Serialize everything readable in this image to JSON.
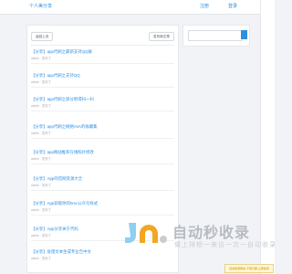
{
  "header": {
    "title": "个人美分享",
    "nav": [
      "注册",
      "登录"
    ]
  },
  "list": {
    "prev_label": "返回上页",
    "edit_label": "发布新文章",
    "items": [
      {
        "title": "【分享】app代刷之最新支持QQ群",
        "meta": "admin  · 发布了"
      },
      {
        "title": "【分享】app代刷之支持QQ",
        "meta": "admin  · 发布了"
      },
      {
        "title": "【分享】app代刷之部分附得扫一扫",
        "meta": "admin  · 发布了"
      },
      {
        "title": "【分享】app代刷之网络AVA的收藏集",
        "meta": "admin  · 发布了"
      },
      {
        "title": "【分享】app网站推荐在线照片修改",
        "meta": "admin  · 发布了"
      },
      {
        "title": "【分享】App的官网资源大全",
        "meta": "admin  · 发布了"
      },
      {
        "title": "【分享】App获取你的bmc公众号样式",
        "meta": "admin  · 发布了"
      },
      {
        "title": "【分享】App分享关于代码",
        "meta": "admin  · 发布了"
      },
      {
        "title": "【分享】处理文本生成专业告中文",
        "meta": "admin  · 发布了"
      }
    ]
  },
  "watermark": {
    "banner": "自动收录网站 不限日期 立即收录",
    "logo_text": "自动秒收录",
    "sub_text": "做上排榜一来访一次一自动收录"
  },
  "colors": {
    "accent": "#2f8fe0"
  }
}
